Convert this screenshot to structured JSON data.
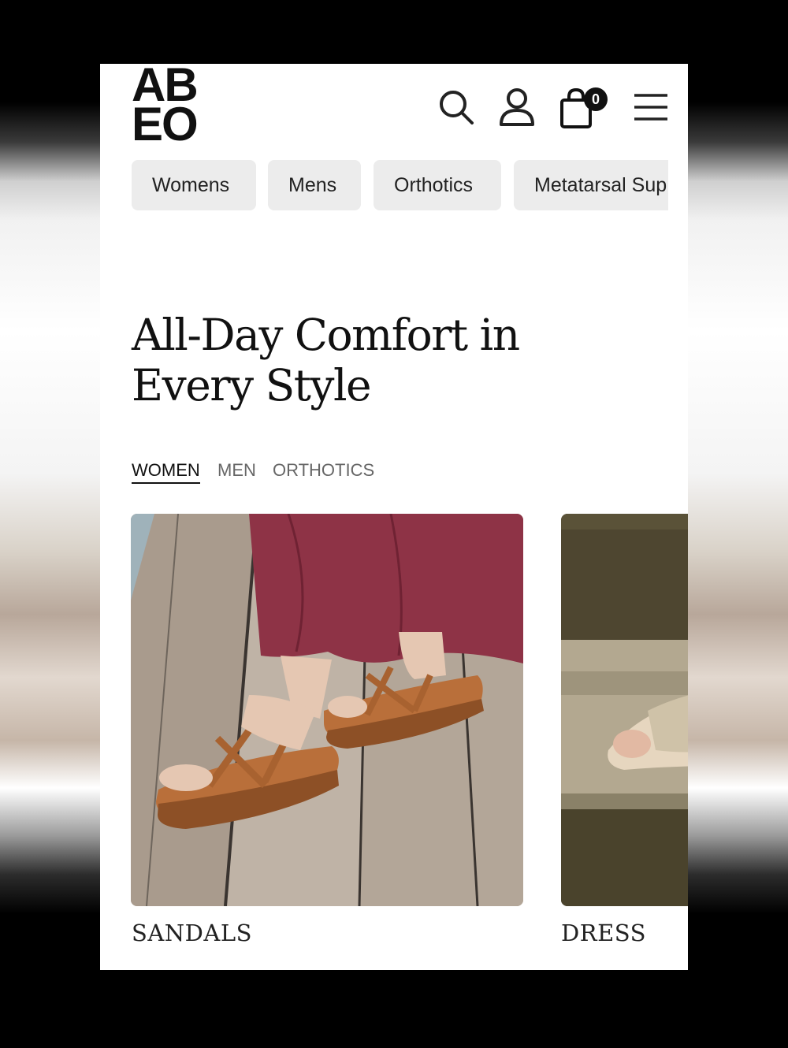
{
  "brand": {
    "logo_line1": "AB",
    "logo_line2": "EO"
  },
  "header": {
    "cart_count": "0",
    "icons": [
      "search-icon",
      "user-icon",
      "bag-icon",
      "menu-icon"
    ]
  },
  "categories": [
    "Womens",
    "Mens",
    "Orthotics",
    "Metatarsal Sup"
  ],
  "hero": {
    "title_line1": "All-Day Comfort in",
    "title_line2": "Every Style"
  },
  "tabs": [
    "WOMEN",
    "MEN",
    "ORTHOTICS"
  ],
  "products": [
    {
      "label": "SANDALS"
    },
    {
      "label": "DRESS"
    }
  ]
}
